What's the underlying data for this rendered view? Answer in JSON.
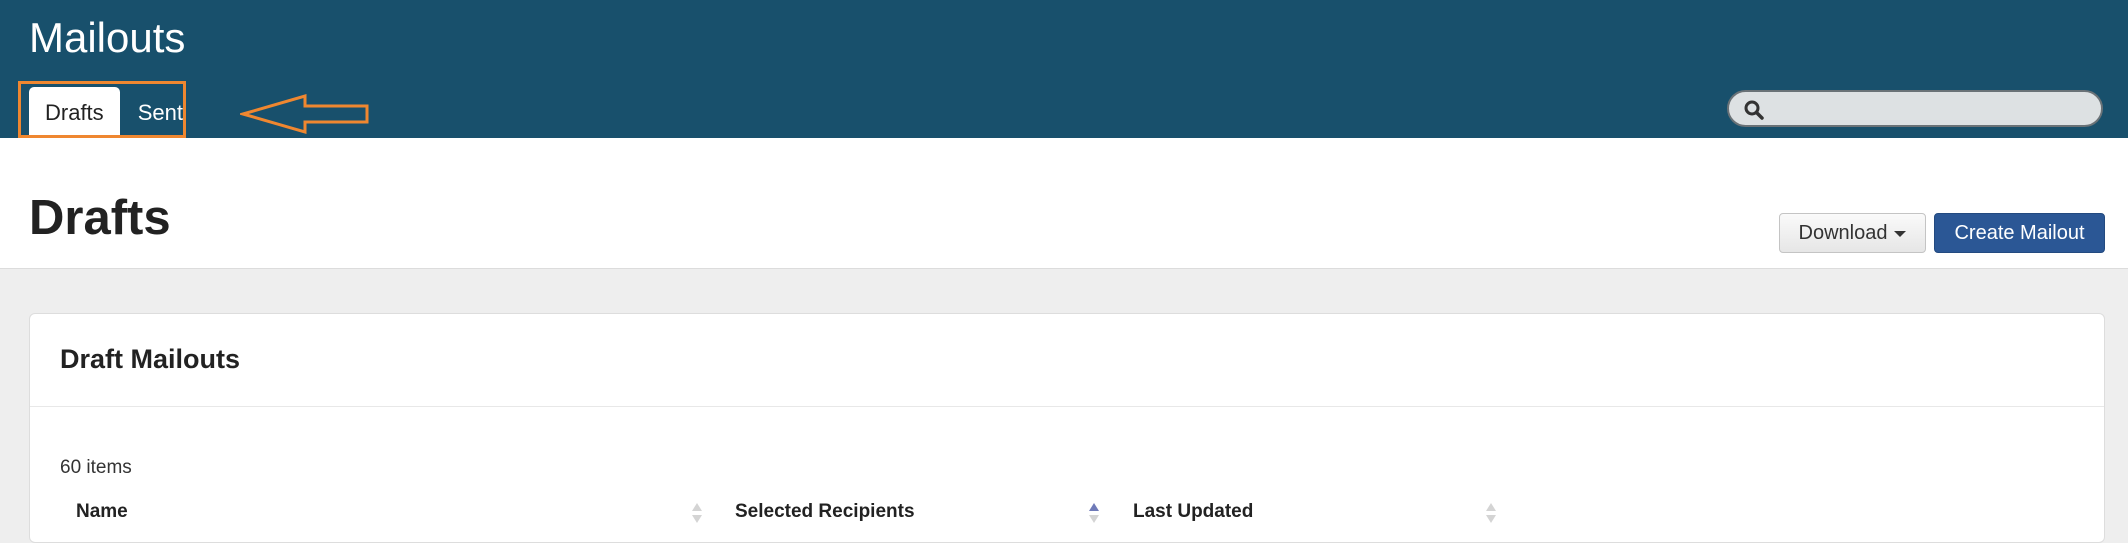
{
  "app": {
    "title": "Mailouts"
  },
  "tabs": [
    {
      "label": "Drafts",
      "active": true
    },
    {
      "label": "Sent",
      "active": false
    }
  ],
  "search": {
    "placeholder": "",
    "value": ""
  },
  "page": {
    "title": "Drafts"
  },
  "actions": {
    "download_label": "Download",
    "create_label": "Create Mailout"
  },
  "panel": {
    "title": "Draft Mailouts",
    "item_count": "60 items",
    "columns": [
      {
        "label": "Name",
        "sort": "none"
      },
      {
        "label": "Selected Recipients",
        "sort": "ascending"
      },
      {
        "label": "Last Updated",
        "sort": "none"
      }
    ]
  },
  "colors": {
    "header_bg": "#18506c",
    "highlight": "#ef8730",
    "primary_button": "#2b5795",
    "page_bg": "#eeeeee"
  },
  "icons": {
    "search": "search-icon",
    "sort": "sort-icon",
    "caret": "caret-down-icon",
    "annotation": "arrow-left-icon"
  }
}
